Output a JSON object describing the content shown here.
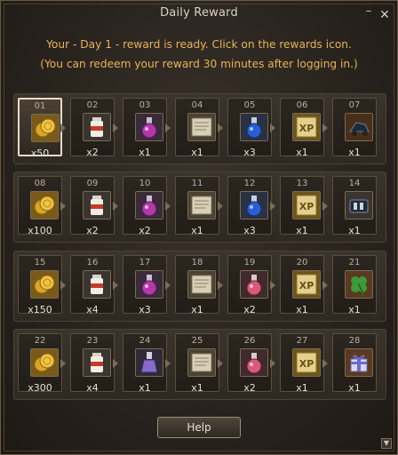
{
  "window": {
    "title": "Daily Reward",
    "minimize_label": "–",
    "close_label": "✕"
  },
  "message": {
    "line1": "Your - Day 1 - reward is ready. Click on the rewards icon.",
    "line2": "(You can redeem your reward 30 minutes after logging in.)"
  },
  "colors": {
    "message": "#e6b35a",
    "title": "#d9d4c7",
    "quantity": "#e5e0d6",
    "day_number": "#b9b09f"
  },
  "rewards": [
    [
      {
        "day": "01",
        "qty": "x50",
        "icon": "gold-coins-icon"
      },
      {
        "day": "02",
        "qty": "x2",
        "icon": "scroll-bottle-icon"
      },
      {
        "day": "03",
        "qty": "x1",
        "icon": "purple-potion-icon"
      },
      {
        "day": "04",
        "qty": "x1",
        "icon": "parchment-scroll-icon"
      },
      {
        "day": "05",
        "qty": "x3",
        "icon": "blue-potion-icon"
      },
      {
        "day": "06",
        "qty": "x1",
        "icon": "xp-book-icon"
      },
      {
        "day": "07",
        "qty": "x1",
        "icon": "vehicle-icon"
      }
    ],
    [
      {
        "day": "08",
        "qty": "x100",
        "icon": "gold-coins-icon"
      },
      {
        "day": "09",
        "qty": "x2",
        "icon": "scroll-bottle-icon"
      },
      {
        "day": "10",
        "qty": "x2",
        "icon": "purple-potion-icon"
      },
      {
        "day": "11",
        "qty": "x1",
        "icon": "parchment-scroll-icon"
      },
      {
        "day": "12",
        "qty": "x3",
        "icon": "blue-potion-icon"
      },
      {
        "day": "13",
        "qty": "x1",
        "icon": "xp-book-icon"
      },
      {
        "day": "14",
        "qty": "x1",
        "icon": "gear-chest-icon"
      }
    ],
    [
      {
        "day": "15",
        "qty": "x150",
        "icon": "gold-coins-icon"
      },
      {
        "day": "16",
        "qty": "x4",
        "icon": "scroll-bottle-icon"
      },
      {
        "day": "17",
        "qty": "x3",
        "icon": "purple-potion-icon"
      },
      {
        "day": "18",
        "qty": "x1",
        "icon": "parchment-scroll-icon"
      },
      {
        "day": "19",
        "qty": "x2",
        "icon": "pink-potion-icon"
      },
      {
        "day": "20",
        "qty": "x1",
        "icon": "xp-book-icon"
      },
      {
        "day": "21",
        "qty": "x1",
        "icon": "clover-icon"
      }
    ],
    [
      {
        "day": "22",
        "qty": "x300",
        "icon": "gold-coins-icon"
      },
      {
        "day": "23",
        "qty": "x4",
        "icon": "scroll-bottle-icon"
      },
      {
        "day": "24",
        "qty": "x1",
        "icon": "violet-flask-icon"
      },
      {
        "day": "25",
        "qty": "x1",
        "icon": "parchment-scroll-icon"
      },
      {
        "day": "26",
        "qty": "x2",
        "icon": "pink-potion-icon"
      },
      {
        "day": "27",
        "qty": "x1",
        "icon": "xp-book-icon"
      },
      {
        "day": "28",
        "qty": "x1",
        "icon": "gift-box-icon"
      }
    ]
  ],
  "help": {
    "label": "Help"
  },
  "scroll": {
    "label": "▼"
  }
}
